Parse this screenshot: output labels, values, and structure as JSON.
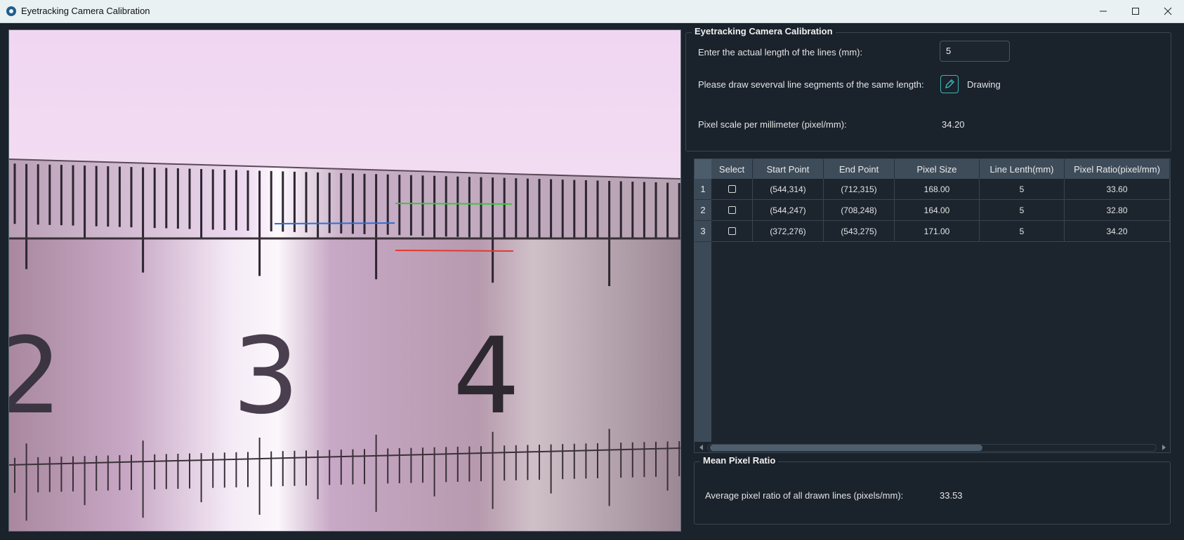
{
  "window": {
    "title": "Eyetracking Camera Calibration"
  },
  "calibration": {
    "group_title": "Eyetracking Camera Calibration",
    "length_label": "Enter the actual length of the lines (mm):",
    "length_value": "5",
    "draw_label": "Please draw severval line segments of the same length:",
    "draw_button_label": "Drawing",
    "scale_label": "Pixel scale per millimeter (pixel/mm):",
    "scale_value": "34.20"
  },
  "table": {
    "headers": [
      "Select",
      "Start Point",
      "End Point",
      "Pixel Size",
      "Line Lenth(mm)",
      "Pixel Ratio(pixel/mm)"
    ],
    "rows": [
      {
        "num": "1",
        "start": "(544,314)",
        "end": "(712,315)",
        "pixel_size": "168.00",
        "length": "5",
        "ratio": "33.60",
        "selected": false
      },
      {
        "num": "2",
        "start": "(544,247)",
        "end": "(708,248)",
        "pixel_size": "164.00",
        "length": "5",
        "ratio": "32.80",
        "selected": false
      },
      {
        "num": "3",
        "start": "(372,276)",
        "end": "(543,275)",
        "pixel_size": "171.00",
        "length": "5",
        "ratio": "34.20",
        "selected": false
      }
    ]
  },
  "mean": {
    "group_title": "Mean Pixel Ratio",
    "label": "Average pixel ratio of all drawn lines (pixels/mm):",
    "value": "33.53"
  },
  "camera": {
    "scale_numbers": [
      "2",
      "3",
      "4"
    ],
    "line_colors": {
      "green": "#3cc63c",
      "blue": "#2e6fd6",
      "red": "#e23a2e"
    }
  },
  "colors": {
    "accent": "#3fb6b8",
    "background": "#1a222b"
  }
}
